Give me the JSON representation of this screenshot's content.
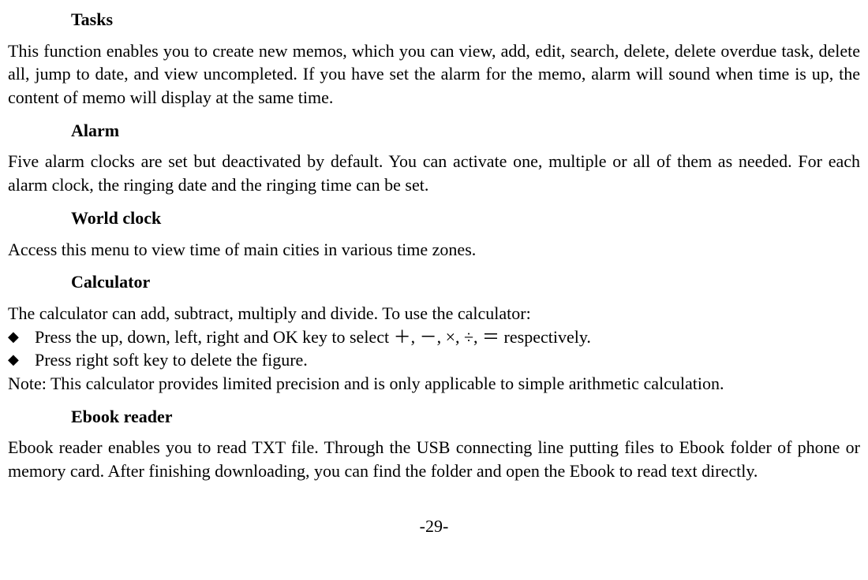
{
  "sections": {
    "tasks": {
      "title": "Tasks",
      "body": "This function enables you to create new memos, which you can view, add, edit, search, delete, delete overdue task, delete all, jump to date, and view uncompleted. If you have set the alarm for the memo, alarm will sound when time is up, the content of memo will display at the same time."
    },
    "alarm": {
      "title": "Alarm",
      "body": "Five alarm clocks are set but deactivated by default. You can activate one, multiple or all of them as needed. For each alarm clock, the ringing date and the ringing time can be set."
    },
    "worldclock": {
      "title": "World clock",
      "body": "Access this menu to view time of main cities in various time zones."
    },
    "calculator": {
      "title": "Calculator",
      "intro": "The calculator can add, subtract, multiply and divide. To use the calculator:",
      "bullet1": "Press the up, down, left, right and OK key to select ＋, －, ×, ÷, ＝ respectively.",
      "bullet2": "Press right soft key to delete the figure.",
      "note": "Note: This calculator provides limited precision and is only applicable to simple arithmetic calculation."
    },
    "ebook": {
      "title": "Ebook reader",
      "body": "Ebook reader enables you to read TXT file. Through the USB connecting line putting files to Ebook folder of phone or memory card. After finishing downloading, you can find the folder and open the Ebook to read text directly."
    }
  },
  "pageNumber": "-29-"
}
